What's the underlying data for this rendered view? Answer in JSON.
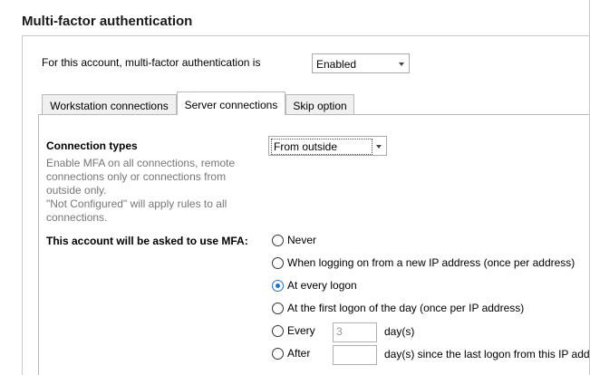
{
  "section": {
    "title": "Multi-factor authentication"
  },
  "account": {
    "label": "For this account, multi-factor authentication is",
    "mfa_status": "Enabled"
  },
  "tabs": [
    {
      "label": "Workstation connections",
      "active": false
    },
    {
      "label": "Server connections",
      "active": true
    },
    {
      "label": "Skip option",
      "active": false
    }
  ],
  "connection_types": {
    "title": "Connection types",
    "description": [
      "Enable MFA on all connections, remote",
      "connections only or connections from",
      "outside only.",
      "\"Not Configured\" will apply rules to all",
      "connections."
    ],
    "selected": "From outside"
  },
  "ask_mfa": {
    "label": "This account will be asked to use MFA:",
    "options": [
      {
        "label": "Never",
        "checked": false
      },
      {
        "label": "When logging on from a new IP address (once per address)",
        "checked": false
      },
      {
        "label": "At every logon",
        "checked": true
      },
      {
        "label": "At the first logon of the day (once per IP address)",
        "checked": false
      },
      {
        "label": "Every",
        "checked": false
      },
      {
        "label": "After",
        "checked": false
      }
    ],
    "every_value": "3",
    "every_unit": "day(s)",
    "after_value": "",
    "after_unit": "day(s) since the last logon from this IP addr"
  },
  "colors": {
    "accent": "#2472c8",
    "border": "#c8c8c8",
    "muted_text": "#777777"
  }
}
